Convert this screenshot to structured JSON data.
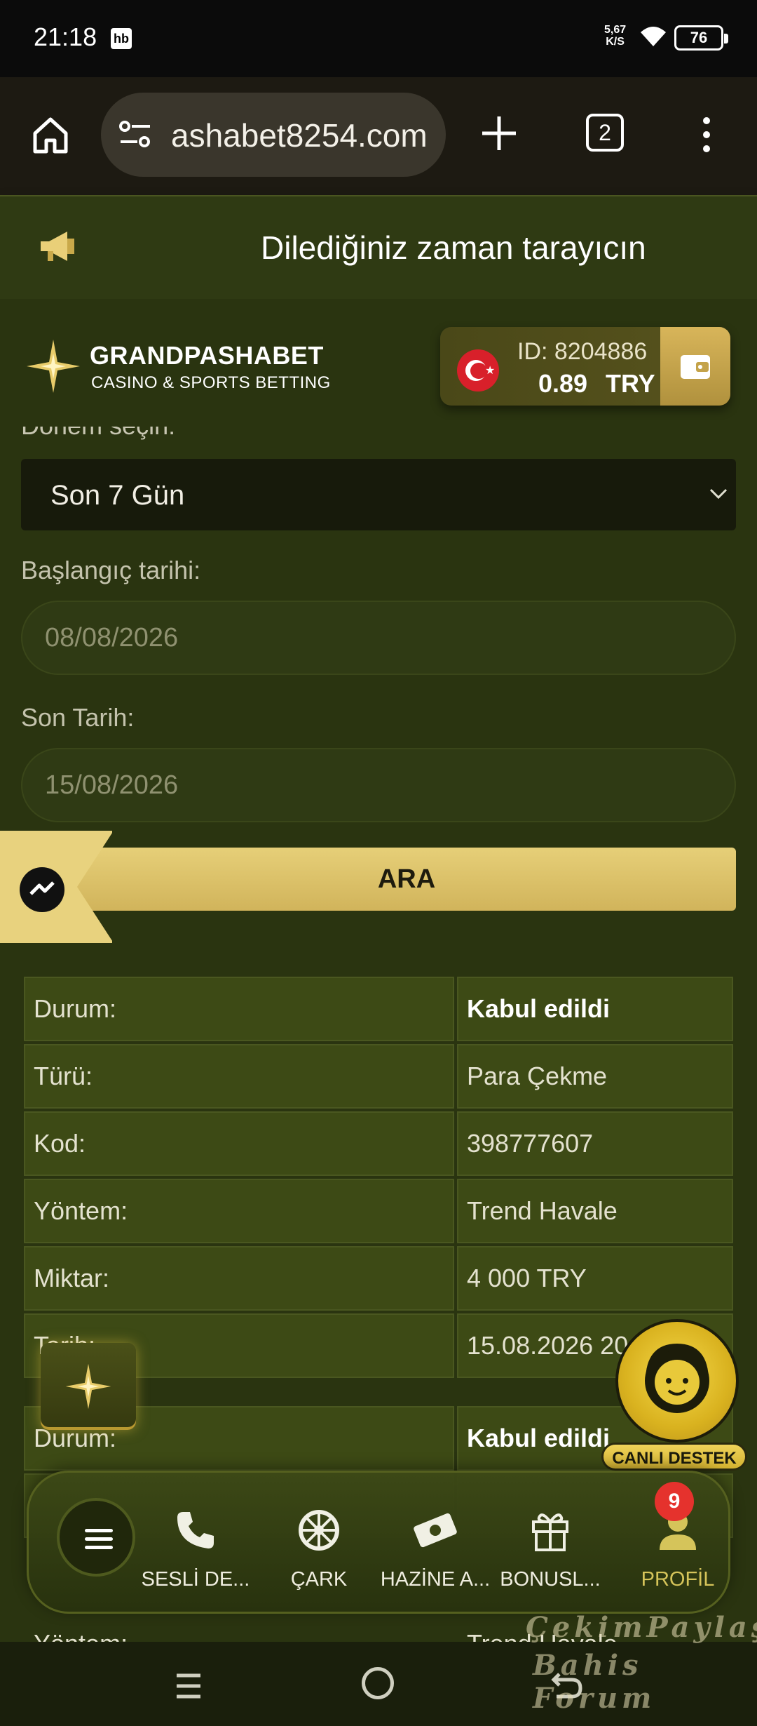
{
  "status_bar": {
    "time": "21:18",
    "notification_icon": "hb",
    "net_speed_value": "5,67",
    "net_speed_unit": "K/S",
    "battery": "76"
  },
  "browser": {
    "url": "ashabet8254.com",
    "tab_count": "2"
  },
  "announcement": {
    "text": "Dilediğiniz zaman tarayıcın"
  },
  "header": {
    "brand_name": "GRANDPASHABET",
    "brand_subtitle": "CASINO & SPORTS BETTING",
    "account_id": "ID: 8204886",
    "balance": "0.89",
    "currency": "TRY"
  },
  "filters": {
    "period_label": "Dönem seçin:",
    "period_value": "Son 7 Gün",
    "start_label": "Başlangıç tarihi:",
    "start_value": "08/08/2026",
    "end_label": "Son Tarih:",
    "end_value": "15/08/2026",
    "search_button": "ARA"
  },
  "transactions": [
    {
      "rows": [
        {
          "key": "Durum:",
          "value": "Kabul edildi"
        },
        {
          "key": "Türü:",
          "value": "Para Çekme"
        },
        {
          "key": "Kod:",
          "value": "398777607"
        },
        {
          "key": "Yöntem:",
          "value": "Trend Havale"
        },
        {
          "key": "Miktar:",
          "value": "4 000 TRY"
        },
        {
          "key": "Tarih:",
          "value": "15.08.2026 20"
        }
      ]
    },
    {
      "rows": [
        {
          "key": "Durum:",
          "value": "Kabul edildi"
        }
      ]
    }
  ],
  "partial_row": {
    "key": "Yöntem:",
    "value": "Trend Havale"
  },
  "support": {
    "label": "CANLI DESTEK"
  },
  "bottom_nav": {
    "items": [
      {
        "label": "SESLİ DE...",
        "icon": "phone-icon"
      },
      {
        "label": "ÇARK",
        "icon": "wheel-icon"
      },
      {
        "label": "HAZİNE A...",
        "icon": "money-icon"
      },
      {
        "label": "BONUSL...",
        "icon": "gift-icon"
      },
      {
        "label": "PROFİL",
        "icon": "user-icon"
      }
    ],
    "profile_badge": "9"
  },
  "watermark": {
    "line1": "ÇekimPaylaş",
    "line2": "Bahis Forum"
  },
  "colors": {
    "accent_gold": "#d8b55a",
    "background": "#2a3410",
    "badge_red": "#e5322d"
  }
}
